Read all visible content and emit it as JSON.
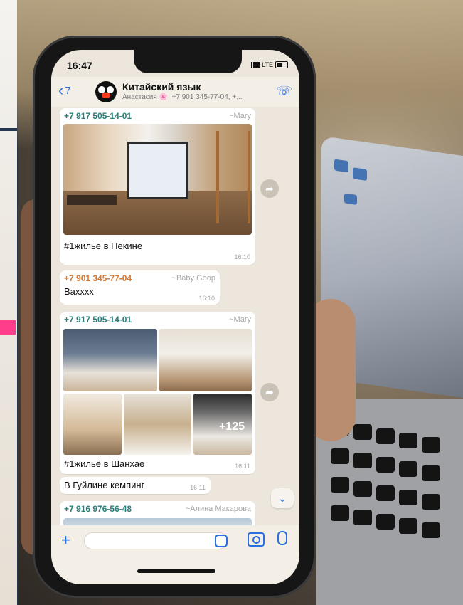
{
  "status": {
    "time": "16:47",
    "network": "LTE"
  },
  "header": {
    "back_count": "7",
    "title": "Китайский язык",
    "subtitle": "Анастасия 🌸, +7 901 345-77-04, +..."
  },
  "messages": [
    {
      "sender": "+7 917 505-14-01",
      "alias": "~Mary",
      "caption": "#1жилье в Пекине",
      "time": "16:10"
    },
    {
      "sender": "+7 901 345-77-04",
      "alias": "~Baby Goop",
      "caption": "Ваxxxx",
      "time": "16:10"
    },
    {
      "sender": "+7 917 505-14-01",
      "alias": "~Mary",
      "caption": "#1жильё в Шанхае",
      "time": "16:11",
      "more_photos": "+125"
    },
    {
      "caption": "В Гуйлине кемпинг",
      "time": "16:11"
    },
    {
      "sender": "+7 916 976-56-48",
      "alias": "~Алина Макарова"
    }
  ],
  "icons": {
    "forward": "forward-icon",
    "scroll_down": "chevron-down-icon",
    "call": "add-call-icon"
  },
  "colors": {
    "accent": "#2b6fe0",
    "sender_teal": "#2a7f7a",
    "sender_orange": "#d9772e"
  }
}
